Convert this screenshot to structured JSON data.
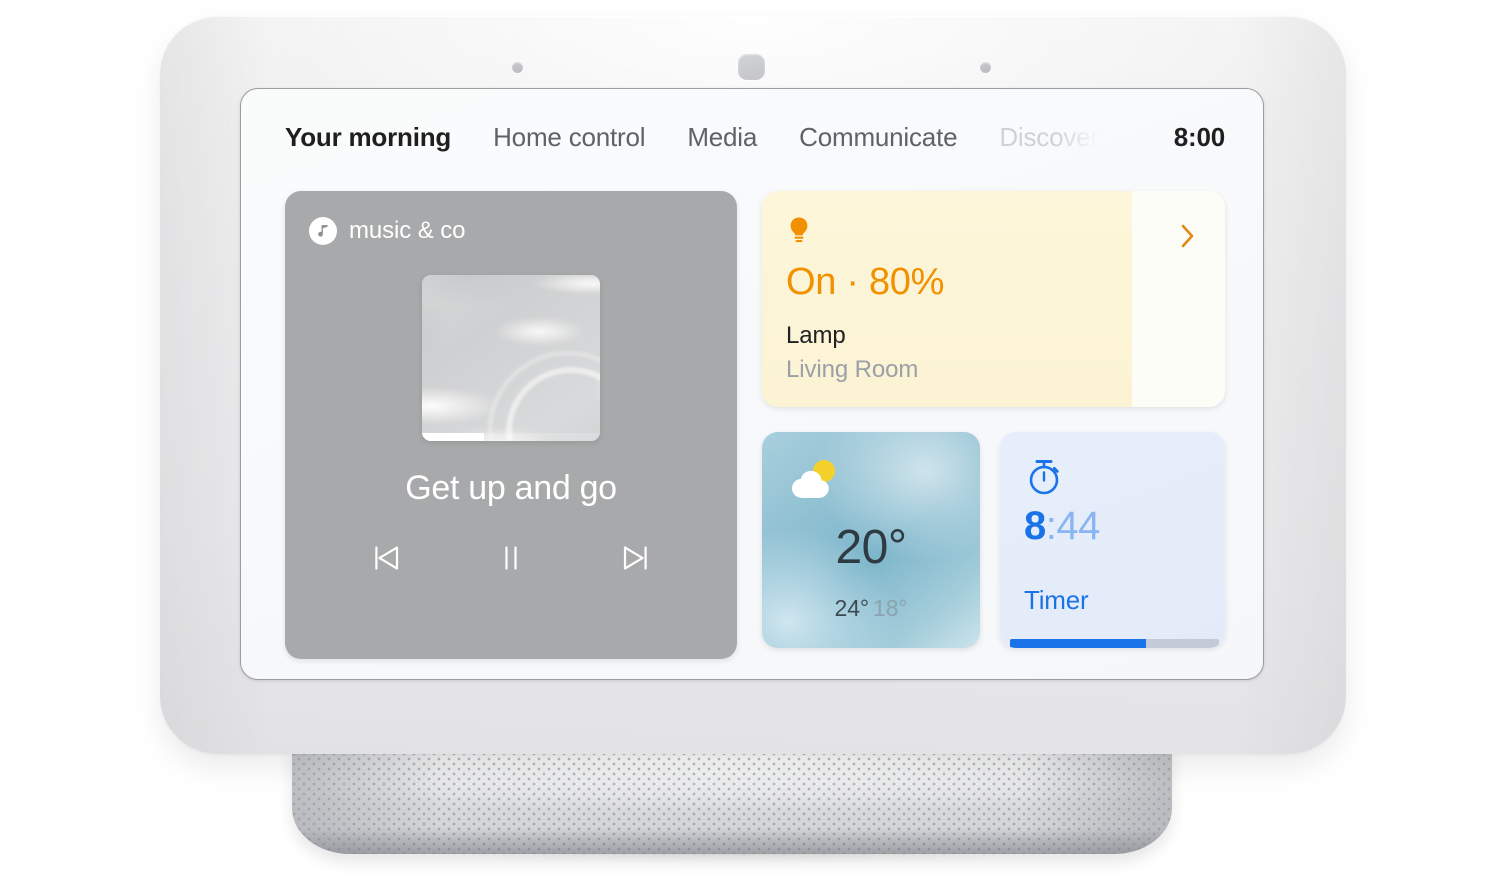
{
  "device": {
    "name": "smart-display",
    "sensors": [
      "ambient-light-sensor-left",
      "camera-sensor",
      "ambient-light-sensor-right"
    ]
  },
  "nav": {
    "items": [
      {
        "label": "Your morning",
        "state": "active"
      },
      {
        "label": "Home control",
        "state": "normal"
      },
      {
        "label": "Media",
        "state": "normal"
      },
      {
        "label": "Communicate",
        "state": "normal"
      },
      {
        "label": "Discover",
        "state": "muted"
      }
    ],
    "clock": "8:00"
  },
  "media": {
    "provider": "music & co",
    "provider_icon": "music-note-icon",
    "track_title": "Get up and go",
    "progress_percent": 35,
    "album_art": "water-caustics-artwork",
    "controls": [
      {
        "name": "previous-track-button",
        "icon": "skip-previous-icon"
      },
      {
        "name": "pause-button",
        "icon": "pause-icon"
      },
      {
        "name": "next-track-button",
        "icon": "skip-next-icon"
      }
    ]
  },
  "lamp": {
    "icon": "lightbulb-icon",
    "state": "On · 80%",
    "brightness_percent": 80,
    "name": "Lamp",
    "room": "Living Room",
    "chevron_icon": "chevron-right-icon",
    "accent_color": "#f29100",
    "fill_color": "#fcf4d6"
  },
  "weather": {
    "icon": "partly-cloudy-day-icon",
    "temperature": "20°",
    "high": "24°",
    "low": "18°"
  },
  "timer": {
    "icon": "stopwatch-icon",
    "value_major": "8",
    "value_minor": ":44",
    "label": "Timer",
    "progress_percent": 65,
    "accent_color": "#1a73e8"
  }
}
